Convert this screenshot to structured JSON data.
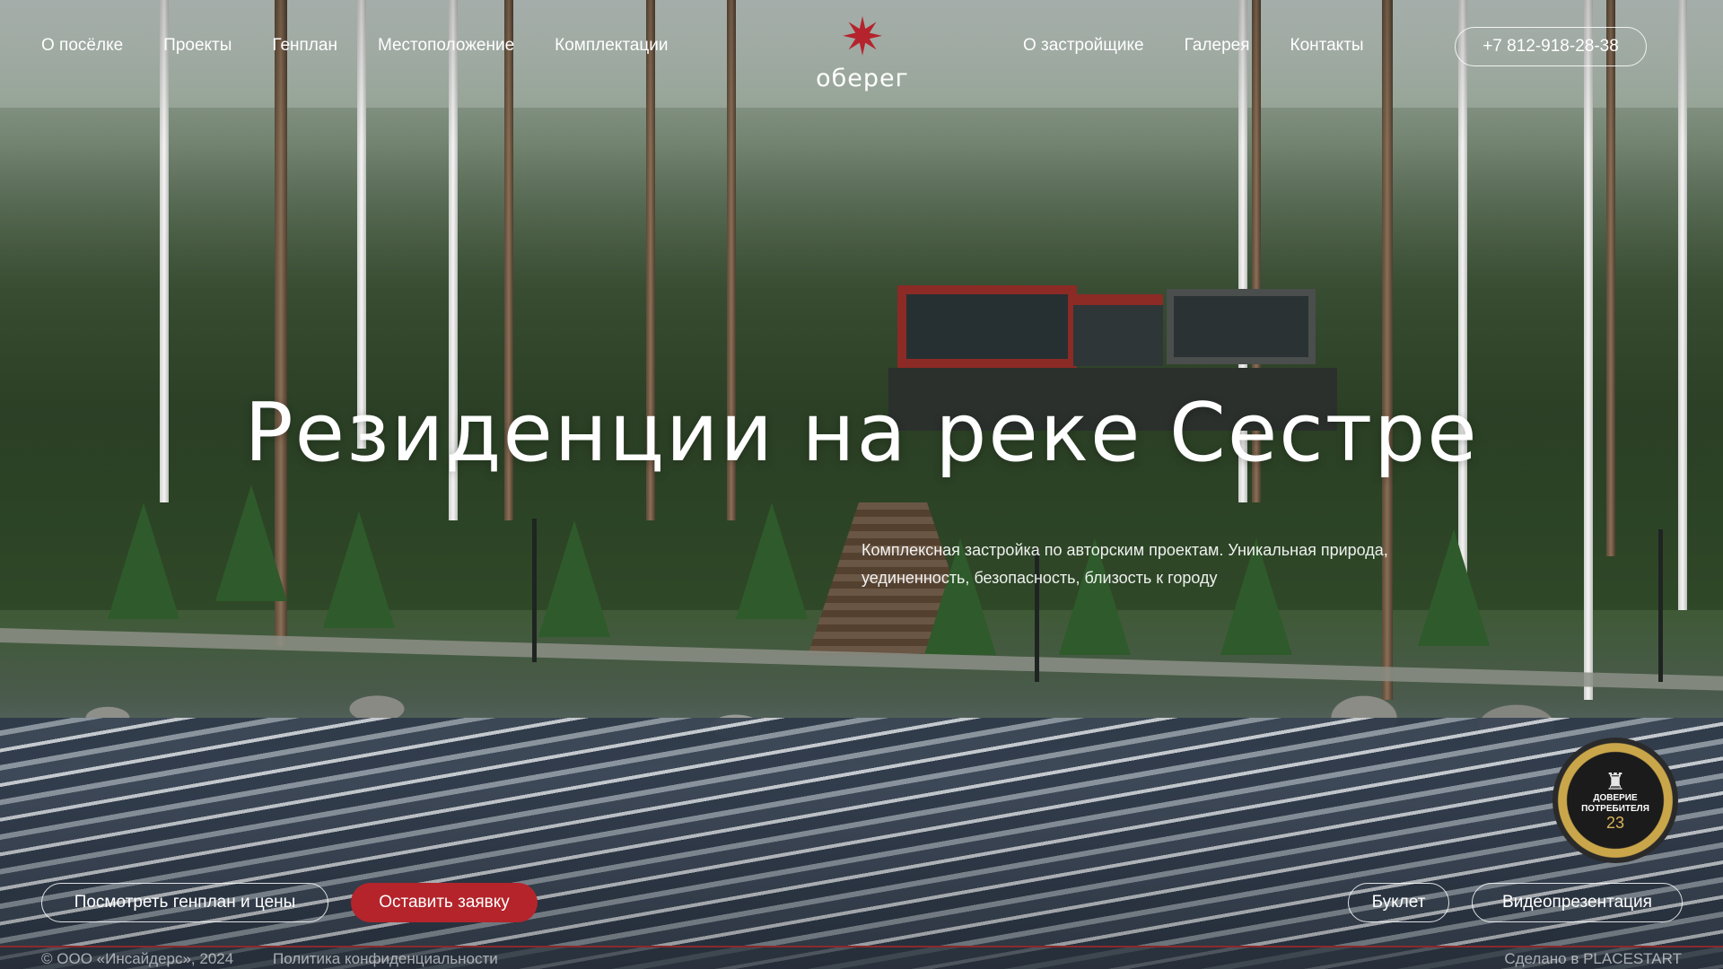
{
  "header": {
    "nav_left": [
      "О посёлке",
      "Проекты",
      "Генплан",
      "Местоположение",
      "Комплектации"
    ],
    "nav_right": [
      "О застройщике",
      "Галерея",
      "Контакты"
    ],
    "logo_text": "оберег",
    "logo_icon": "star-flower-icon",
    "phone": "+7 812-918-28-38"
  },
  "hero": {
    "title": "Резиденции на реке Сестре",
    "subtitle_line1": "Комплексная застройка по авторским проектам. Уникальная природа,",
    "subtitle_line2": "уединенность, безопасность, близость к городу"
  },
  "actions": {
    "genplan_button": "Посмотреть генплан и цены",
    "request_button": "Оставить заявку",
    "booklet_button": "Буклет",
    "video_button": "Видеопрезентация"
  },
  "badge": {
    "line1": "ДОВЕРИЕ",
    "line2": "ПОТРЕБИТЕЛЯ",
    "number": "23"
  },
  "footer": {
    "copyright": "© ООО «Инсайдерс», 2024",
    "privacy": "Политика конфиденциальности",
    "made_by": "Сделано в PLACESTART"
  },
  "colors": {
    "accent_red": "#b5242b",
    "logo_red": "#b5232c"
  }
}
